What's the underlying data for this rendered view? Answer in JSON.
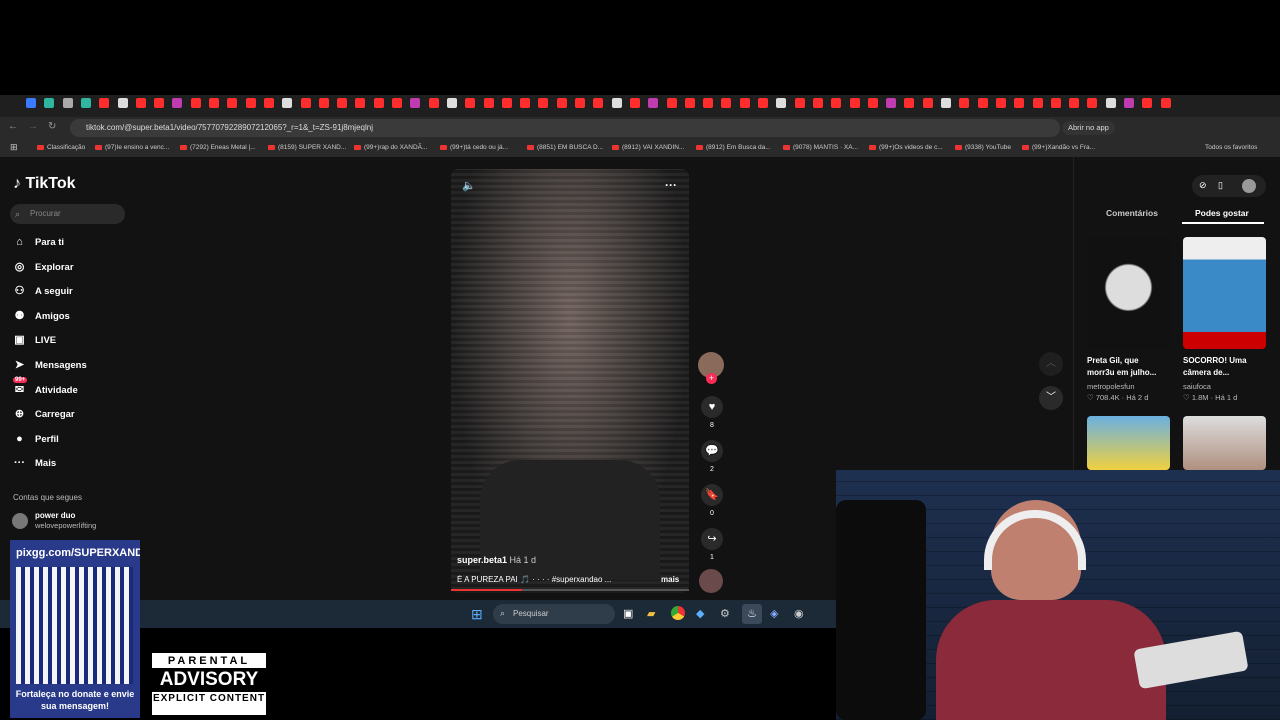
{
  "browser": {
    "url": "tiktok.com/@super.beta1/video/7577079228907212065?_r=1&_t=ZS-91j8mjeqlnj",
    "open_app_label": "Abrir no app",
    "bookmarks": [
      "Classificação",
      "(97)Ie ensino a venc...",
      "(7292) Eneas Metal |...",
      "(8159) SUPER XAND...",
      "(99+)rap do XANDÃ...",
      "(99+)tá cedo ou já...",
      "(8851) EM BUSCA D...",
      "(8912) VAI XANDIN...",
      "(8912) Em Busca da...",
      "(9078) MANTIS · XA...",
      "(99+)Os videos de c...",
      "(9338) YouTube",
      "(99+)Xandão vs Fra..."
    ],
    "all_favorites": "Todos os favoritos"
  },
  "tiktok": {
    "logo": "TikTok",
    "search_placeholder": "Procurar",
    "nav": [
      {
        "label": "Para ti",
        "icon": "home-icon"
      },
      {
        "label": "Explorar",
        "icon": "compass-icon"
      },
      {
        "label": "A seguir",
        "icon": "following-icon"
      },
      {
        "label": "Amigos",
        "icon": "friends-icon"
      },
      {
        "label": "LIVE",
        "icon": "live-icon"
      },
      {
        "label": "Mensagens",
        "icon": "messages-icon"
      },
      {
        "label": "Atividade",
        "icon": "activity-icon"
      },
      {
        "label": "Carregar",
        "icon": "upload-icon"
      },
      {
        "label": "Perfil",
        "icon": "avatar-icon"
      },
      {
        "label": "Mais",
        "icon": "more-icon"
      }
    ],
    "activity_badge": "99+",
    "following_title": "Contas que segues",
    "following": [
      {
        "name": "power duo",
        "handle": "welovepowerlifting"
      }
    ],
    "video": {
      "author": "super.beta1",
      "time": "Há 1 d",
      "caption": "É A PUREZA PAI 🎵 · · · · #superxandao ...",
      "more": "mais",
      "likes": "8",
      "comments": "2",
      "saves": "0",
      "shares": "1"
    },
    "tabs": {
      "comments": "Comentários",
      "suggested": "Podes gostar"
    },
    "suggestions": [
      {
        "title": "Preta Gil, que morr3u em julho...",
        "author": "metropolesfun",
        "likes": "708.4K",
        "time": "Há 2 d"
      },
      {
        "title": "SOCORRO! Uma câmera de...",
        "author": "saiufoca",
        "likes": "1.8M",
        "time": "Há 1 d"
      }
    ]
  },
  "taskbar": {
    "search": "Pesquisar"
  },
  "overlay": {
    "pix_url": "pixgg.com/SUPERXANDÃO",
    "pix_text": "Fortaleça no donate e envie sua mensagem!",
    "advisory_top": "PARENTAL",
    "advisory_mid": "ADVISORY",
    "advisory_bottom": "EXPLICIT CONTENT"
  }
}
